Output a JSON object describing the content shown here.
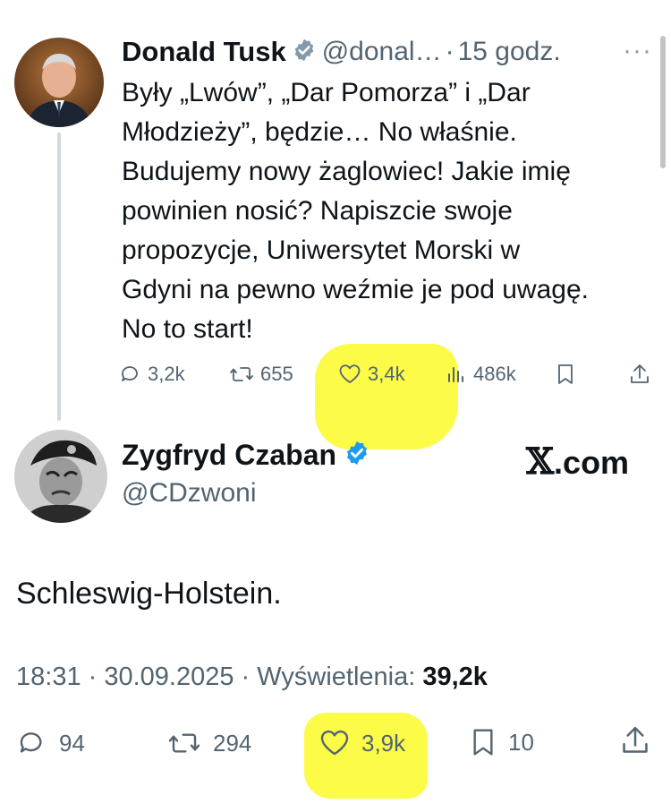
{
  "original_tweet": {
    "author_name": "Donald Tusk",
    "handle": "@donal…",
    "separator": "·",
    "time_ago": "15 godz.",
    "more_icon": "more-dots-icon",
    "text": "Były „Lwów”, „Dar Pomorza” i „Dar\nMłodzieży”, będzie… No właśnie.\nBudujemy nowy żaglowiec! Jakie imię\npowinien nosić? Napiszcie swoje\npropozycje, Uniwersytet Morski w\nGdyni na pewno weźmie je pod uwagę.\nNo to start!",
    "actions": {
      "replies": "3,2k",
      "reposts": "655",
      "likes": "3,4k",
      "views": "486k"
    },
    "verified_color": "#829aab"
  },
  "reply": {
    "author_name": "Zygfryd Czaban",
    "handle": "@CDzwoni",
    "watermark_x": "𝕏",
    "watermark_rest": ".com",
    "text": "Schleswig-Holstein.",
    "timestamp": "18:31 · 30.09.2025 · Wyświetlenia: ",
    "views_count": "39,2k",
    "actions": {
      "replies": "94",
      "reposts": "294",
      "likes": "3,9k",
      "bookmarks": "10"
    },
    "verified_color": "#1d9bf0"
  },
  "colors": {
    "text_primary": "#0f1419",
    "text_secondary": "#536471",
    "highlight": "#fafa28"
  }
}
